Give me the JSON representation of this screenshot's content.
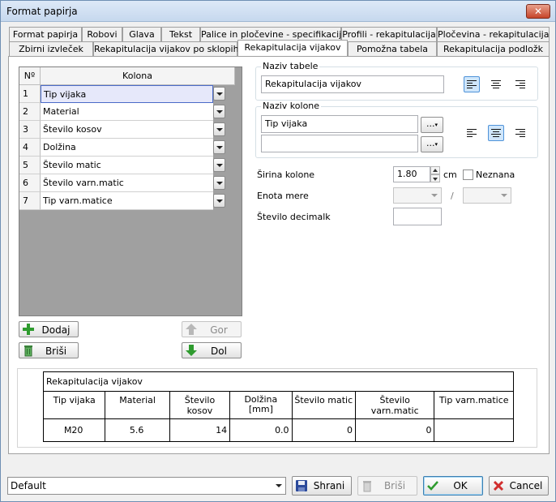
{
  "window": {
    "title": "Format papirja",
    "close_symbol": "✕"
  },
  "tabs_row1": [
    "Format papirja",
    "Robovi",
    "Glava",
    "Tekst",
    "Palice in pločevine - specifikacija",
    "Profili - rekapitulacija",
    "Pločevina - rekapitulacija"
  ],
  "tabs_row2": [
    "Zbirni izvleček",
    "Rekapitulacija vijakov po sklopih",
    "Rekapitulacija vijakov",
    "Pomožna tabela",
    "Rekapitulacija podložk"
  ],
  "active_tab": "Rekapitulacija vijakov",
  "grid": {
    "header_no": "Nº",
    "header_column": "Kolona",
    "rows": [
      {
        "no": "1",
        "value": "Tip vijaka"
      },
      {
        "no": "2",
        "value": "Material"
      },
      {
        "no": "3",
        "value": "Število kosov"
      },
      {
        "no": "4",
        "value": "Dolžina"
      },
      {
        "no": "5",
        "value": "Število matic"
      },
      {
        "no": "6",
        "value": "Število varn.matic"
      },
      {
        "no": "7",
        "value": "Tip varn.matice"
      }
    ],
    "selected_row": 0
  },
  "grid_buttons": {
    "add": "Dodaj",
    "delete": "Briši",
    "up": "Gor",
    "down": "Dol"
  },
  "table_name": {
    "label": "Naziv tabele",
    "value": "Rekapitulacija vijakov",
    "alignment": "left"
  },
  "column_name": {
    "label": "Naziv kolone",
    "line1": "Tip vijaka",
    "line2": "",
    "browse": "...",
    "alignment": "center"
  },
  "column_width": {
    "label": "Širina kolone",
    "value": "1.80",
    "unit": "cm",
    "unknown_label": "Neznana",
    "unknown_checked": false
  },
  "unit_of_measure": {
    "label": "Enota mere",
    "separator": "/"
  },
  "decimals": {
    "label": "Število decimalk",
    "value": ""
  },
  "preview": {
    "title": "Rekapitulacija vijakov",
    "headers": [
      "Tip vijaka",
      "Material",
      "Število kosov",
      "Dolžina\n[mm]",
      "Število matic",
      "Število varn.matic",
      "Tip varn.matice"
    ],
    "row": [
      "M20",
      "5.6",
      "14",
      "0.0",
      "0",
      "0",
      ""
    ]
  },
  "footer": {
    "preset_value": "Default",
    "save": "Shrani",
    "delete": "Briši",
    "ok": "OK",
    "cancel": "Cancel"
  }
}
